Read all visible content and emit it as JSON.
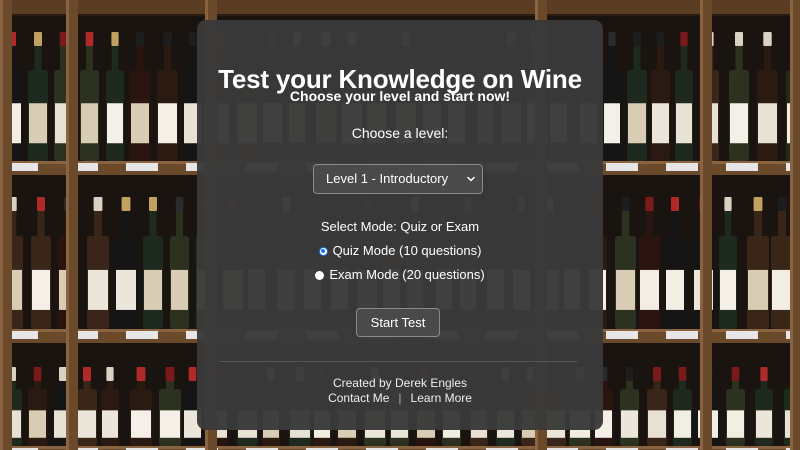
{
  "page": {
    "title": "Test your Knowledge on Wine",
    "subtitle": "Choose your level and start now!"
  },
  "level": {
    "label": "Choose a level:",
    "selected": "Level 1 - Introductory"
  },
  "mode": {
    "label": "Select Mode: Quiz or Exam",
    "options": [
      {
        "label": "Quiz Mode (10 questions)",
        "checked": true
      },
      {
        "label": "Exam Mode (20 questions)",
        "checked": false
      }
    ]
  },
  "actions": {
    "start_label": "Start Test"
  },
  "footer": {
    "credit": "Created by Derek Engles",
    "separator": "|",
    "links": [
      {
        "label": "Contact Me"
      },
      {
        "label": "Learn More"
      }
    ]
  },
  "colors": {
    "card_bg": "#3a3a3a",
    "radio_accent": "#1a73e8",
    "shelf_wood": "#6b4a2b"
  }
}
